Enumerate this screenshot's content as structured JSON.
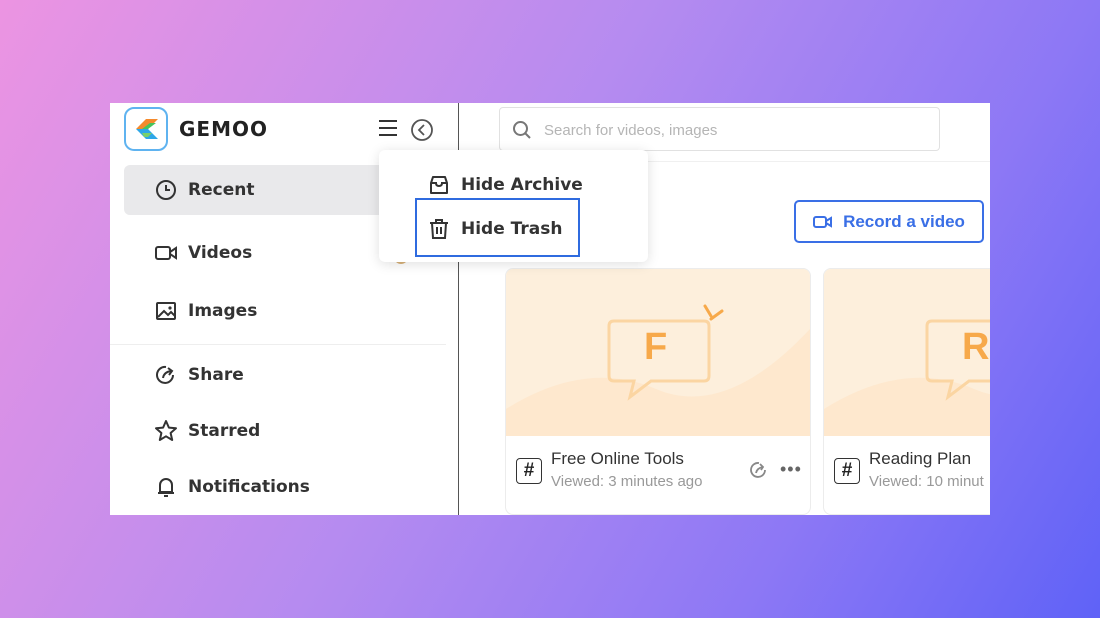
{
  "app": {
    "brand": "GEMOO"
  },
  "search": {
    "placeholder": "Search for videos, images"
  },
  "sidebar": {
    "items": [
      {
        "label": "Recent",
        "icon": "clock-icon",
        "active": true
      },
      {
        "label": "Videos",
        "icon": "video-icon"
      },
      {
        "label": "Images",
        "icon": "image-icon"
      },
      {
        "label": "Share",
        "icon": "share-icon"
      },
      {
        "label": "Starred",
        "icon": "star-icon"
      },
      {
        "label": "Notifications",
        "icon": "bell-icon"
      }
    ]
  },
  "dropdown": {
    "items": [
      {
        "label": "Hide Archive",
        "icon": "archive-icon"
      },
      {
        "label": "Hide Trash",
        "icon": "trash-icon",
        "highlighted": true
      }
    ]
  },
  "toolbar": {
    "record_label": "Record a video"
  },
  "cards": [
    {
      "letter": "F",
      "title": "Free Online Tools",
      "subtitle": "Viewed: 3 minutes ago",
      "tag": "#"
    },
    {
      "letter": "R",
      "title": "Reading Plan",
      "subtitle": "Viewed: 10 minut",
      "tag": "#"
    }
  ],
  "colors": {
    "accent": "#3a6fe6",
    "highlight_border": "#2f6bdf",
    "thumb_bg": "#fdefdc",
    "thumb_letter": "#f7a94a"
  }
}
